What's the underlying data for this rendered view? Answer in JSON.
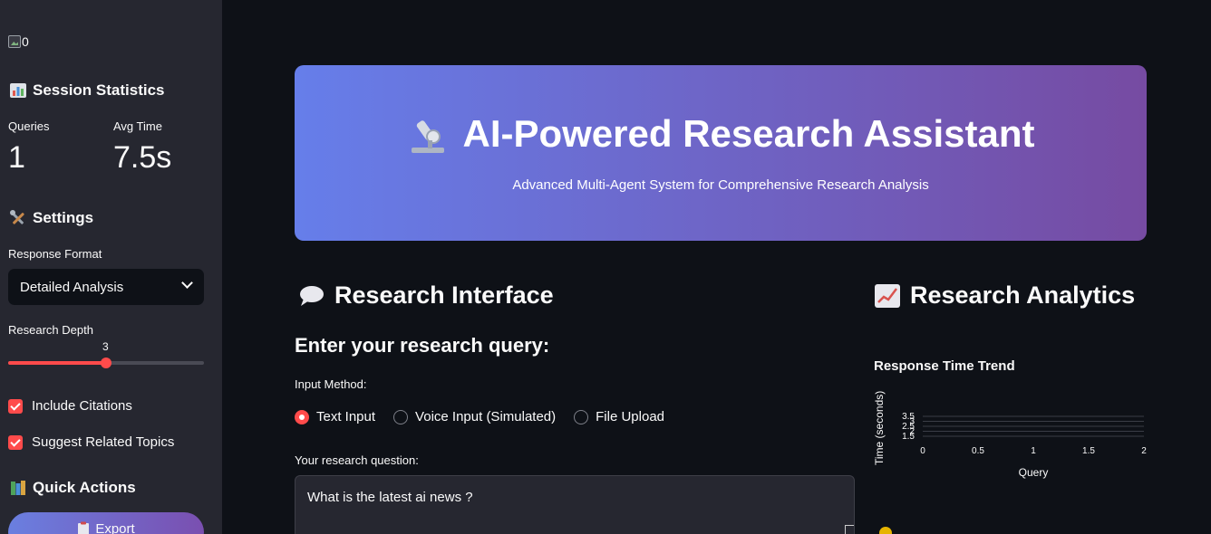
{
  "sidebar": {
    "logo_alt": "0",
    "session_stats": {
      "title": "Session Statistics"
    },
    "metrics": [
      {
        "label": "Queries",
        "value": "1"
      },
      {
        "label": "Avg Time",
        "value": "7.5s"
      }
    ],
    "settings": {
      "title": "Settings",
      "response_format_label": "Response Format",
      "response_format_value": "Detailed Analysis",
      "research_depth_label": "Research Depth",
      "research_depth_value": "3",
      "research_depth_fraction": 0.5,
      "checkboxes": [
        {
          "label": "Include Citations",
          "checked": true
        },
        {
          "label": "Suggest Related Topics",
          "checked": true
        }
      ]
    },
    "quick_actions": {
      "title": "Quick Actions",
      "export_label": "Export"
    }
  },
  "hero": {
    "title": "AI-Powered Research Assistant",
    "subtitle": "Advanced Multi-Agent System for Comprehensive Research Analysis"
  },
  "research_interface": {
    "title": "Research Interface",
    "query_heading": "Enter your research query:",
    "input_method_label": "Input Method:",
    "input_methods": [
      {
        "label": "Text Input",
        "selected": true
      },
      {
        "label": "Voice Input (Simulated)",
        "selected": false
      },
      {
        "label": "File Upload",
        "selected": false
      }
    ],
    "question_label": "Your research question:",
    "question_value": "What is the latest ai news ?"
  },
  "analytics": {
    "title": "Research Analytics",
    "chart_title": "Response Time Trend"
  },
  "colors": {
    "accent": "#ff4b4b",
    "gradient_start": "#667eea",
    "gradient_end": "#764ba2",
    "sidebar_bg": "#262730",
    "main_bg": "#0e1117"
  },
  "chart_data": {
    "type": "line",
    "title": "Response Time Trend",
    "xlabel": "Query",
    "ylabel": "Time (seconds)",
    "x_ticks": [
      "0",
      "0.5",
      "1",
      "1.5",
      "2"
    ],
    "y_ticks": [
      "1.5",
      "2",
      "2.5",
      "3",
      "3.5"
    ],
    "xlim": [
      0,
      2
    ],
    "ylim": [
      1.5,
      3.5
    ],
    "series": []
  }
}
